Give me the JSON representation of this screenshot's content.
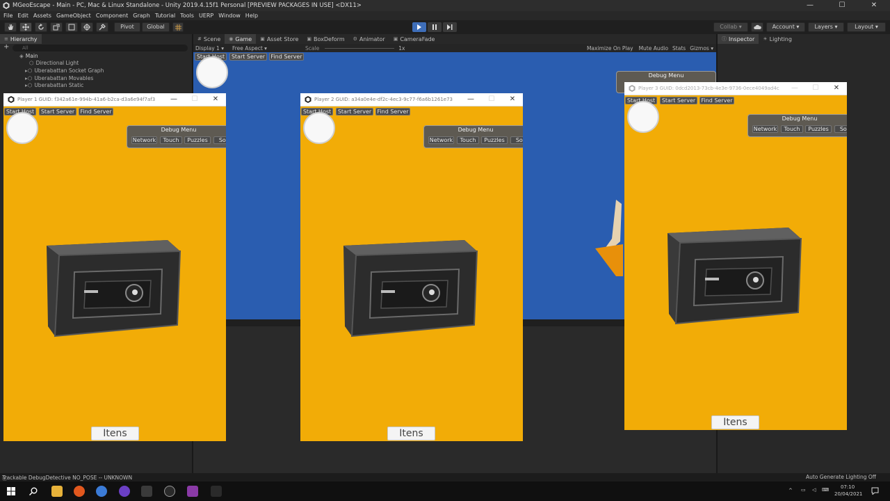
{
  "window": {
    "title": "MGeoEscape - Main - PC, Mac & Linux Standalone - Unity 2019.4.15f1 Personal [PREVIEW PACKAGES IN USE] <DX11>",
    "controls": [
      "—",
      "☐",
      "✕"
    ]
  },
  "menu": [
    "File",
    "Edit",
    "Assets",
    "GameObject",
    "Component",
    "Graph",
    "Tutorial",
    "Tools",
    "UERP",
    "Window",
    "Help"
  ],
  "toolbar": {
    "pivot": "Pivot",
    "global": "Global",
    "collab": "Collab ▾",
    "account": "Account",
    "layers": "Layers",
    "layout": "Layout"
  },
  "hierarchy": {
    "tab": "Hierarchy",
    "search_placeholder": "All",
    "items": [
      {
        "label": "Main",
        "depth": 0
      },
      {
        "label": "Directional Light",
        "depth": 1
      },
      {
        "label": "Uberabattan Socket Graph",
        "depth": 1
      },
      {
        "label": "Uberabattan Movables",
        "depth": 1
      },
      {
        "label": "Uberabattan Static",
        "depth": 1
      }
    ]
  },
  "center_tabs": [
    {
      "label": "Scene",
      "icon": "#"
    },
    {
      "label": "Game",
      "icon": "◉"
    },
    {
      "label": "Asset Store",
      "icon": "▣"
    },
    {
      "label": "BoxDeform",
      "icon": "▣"
    },
    {
      "label": "Animator",
      "icon": "⚙"
    },
    {
      "label": "CameraFade",
      "icon": "▣"
    }
  ],
  "game_toolbar": {
    "display": "Display 1",
    "aspect": "Free Aspect",
    "scale_label": "Scale",
    "scale_value": "1x",
    "options": [
      "Maximize On Play",
      "Mute Audio",
      "Stats",
      "Gizmos"
    ]
  },
  "right_tabs": [
    {
      "label": "Inspector",
      "icon": "ⓘ"
    },
    {
      "label": "Lighting",
      "icon": "☀"
    }
  ],
  "net_buttons": {
    "start_host": "Start Host",
    "start_server": "Start Server",
    "find_server": "Find Server"
  },
  "debug_menu": {
    "title": "Debug Menu",
    "buttons": [
      "Network",
      "Touch",
      "Puzzles",
      "Soc"
    ]
  },
  "players": [
    {
      "title": "Player 1 GUID: f342a61e-994b-41a6-b2ca-d3a6e94f7af3"
    },
    {
      "title": "Player 2 GUID: a34a0e4e-df2c-4ec3-9c77-f6a6b1261e73"
    },
    {
      "title": "Player 3 GUID: 0dcd2013-73cb-4e3e-9736-0ece4049ad4c"
    }
  ],
  "itens_label": "Itens",
  "status": {
    "left": "Trackable DebugDetective NO_POSE -- UNKNOWN",
    "right": "Auto Generate Lighting Off"
  },
  "clock": {
    "time": "07:10",
    "date": "20/04/2021"
  },
  "colors": {
    "game_bg": "#2a5db0",
    "player_bg": "#f2ac07",
    "editor_bg": "#282828",
    "play_active": "#3e6eb9"
  }
}
